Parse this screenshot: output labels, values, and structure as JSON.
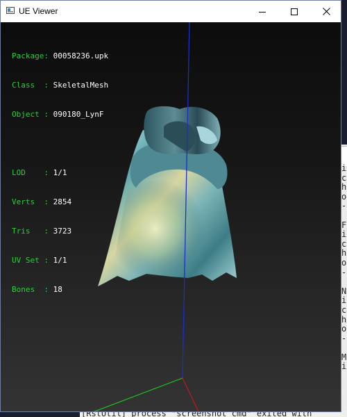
{
  "window": {
    "title": "UE Viewer",
    "minimize_glyph": "minimize-icon",
    "maximize_glyph": "maximize-icon",
    "close_glyph": "close-icon"
  },
  "info": {
    "package_label": "Package: ",
    "package_value": "00058236.upk",
    "class_label": "Class  : ",
    "class_value": "SkeletalMesh",
    "object_label": "Object : ",
    "object_value": "090180_LynF",
    "lod_label": "LOD    : ",
    "lod_value": "1/1",
    "verts_label": "Verts  : ",
    "verts_value": "2854",
    "tris_label": "Tris   : ",
    "tris_value": "3723",
    "uvset_label": "UV Set : ",
    "uvset_value": "1/1",
    "bones_label": "Bones  : ",
    "bones_value": "18"
  },
  "colors": {
    "label_green": "#2ecc40",
    "axis_blue": "#2030c0",
    "axis_green": "#20c020",
    "axis_red": "#c01818"
  },
  "background": {
    "left_glyph": "M",
    "terminal_lines": [
      "i",
      "c",
      "h",
      "o",
      "-",
      "",
      "F",
      "i",
      "c",
      "h",
      "o",
      "-",
      "",
      "N",
      "i",
      "c",
      "h",
      "o",
      "-",
      "",
      "M",
      "i"
    ],
    "bottom_text": "[RstUtil] process \"screenshot_cmd\" exited with"
  }
}
